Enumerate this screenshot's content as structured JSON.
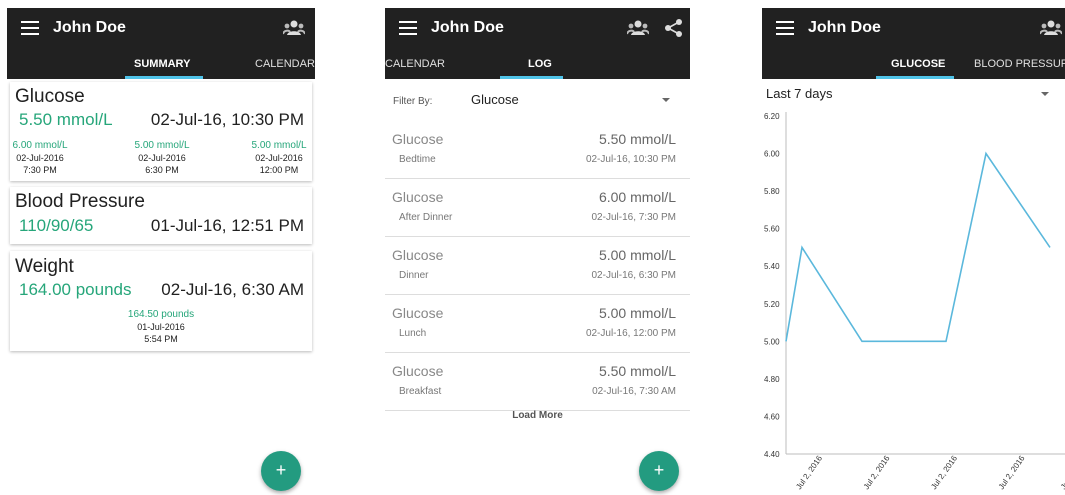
{
  "screens": [
    {
      "title": "John Doe",
      "tabs": [
        {
          "label": "SUMMARY"
        },
        {
          "label": "CALENDAR"
        }
      ],
      "cards": [
        {
          "title": "Glucose",
          "value": "5.50 mmol/L",
          "date": "02-Jul-16, 10:30 PM",
          "history": [
            {
              "value": "6.00 mmol/L",
              "date": "02-Jul-2016",
              "time": "7:30 PM"
            },
            {
              "value": "5.00 mmol/L",
              "date": "02-Jul-2016",
              "time": "6:30 PM"
            },
            {
              "value": "5.00 mmol/L",
              "date": "02-Jul-2016",
              "time": "12:00 PM"
            }
          ]
        },
        {
          "title": "Blood Pressure",
          "value": "110/90/65",
          "date": "01-Jul-16, 12:51 PM"
        },
        {
          "title": "Weight",
          "value": "164.00 pounds",
          "date": "02-Jul-16, 6:30 AM",
          "history": [
            {
              "value": "164.50 pounds",
              "date": "01-Jul-2016",
              "time": "5:54 PM"
            }
          ]
        }
      ],
      "fab": "+"
    },
    {
      "title": "John Doe",
      "tabs": [
        {
          "label": "CALENDAR"
        },
        {
          "label": "LOG"
        }
      ],
      "filter": {
        "label": "Filter By:",
        "value": "Glucose"
      },
      "entries": [
        {
          "type": "Glucose",
          "context": "Bedtime",
          "value": "5.50 mmol/L",
          "datetime": "02-Jul-16, 10:30 PM"
        },
        {
          "type": "Glucose",
          "context": "After Dinner",
          "value": "6.00 mmol/L",
          "datetime": "02-Jul-16, 7:30 PM"
        },
        {
          "type": "Glucose",
          "context": "Dinner",
          "value": "5.00 mmol/L",
          "datetime": "02-Jul-16, 6:30 PM"
        },
        {
          "type": "Glucose",
          "context": "Lunch",
          "value": "5.00 mmol/L",
          "datetime": "02-Jul-16, 12:00 PM"
        },
        {
          "type": "Glucose",
          "context": "Breakfast",
          "value": "5.50 mmol/L",
          "datetime": "02-Jul-16, 7:30 AM"
        }
      ],
      "load_more": "Load More",
      "fab": "+"
    },
    {
      "title": "John Doe",
      "tabs": [
        {
          "label": "GLUCOSE"
        },
        {
          "label": "BLOOD PRESSURE"
        }
      ],
      "range": "Last 7 days"
    }
  ],
  "colors": {
    "appbar": "#212121",
    "accent": "#4fc3e8",
    "value_green": "#26a67a",
    "fab": "#239b80",
    "line": "#5bb8dc"
  },
  "icons": [
    "menu-icon",
    "group-icon",
    "share-icon",
    "dropdown-arrow-icon",
    "add-icon"
  ],
  "chart_data": {
    "type": "line",
    "title": "",
    "xlabel": "",
    "ylabel": "",
    "ylim": [
      4.4,
      6.2
    ],
    "y_ticks": [
      "4.40",
      "4.60",
      "4.80",
      "5.00",
      "5.20",
      "5.40",
      "5.60",
      "5.80",
      "6.00",
      "6.20"
    ],
    "x_tick_labels": [
      "Jul 2, 2016",
      "Jul 2, 2016",
      "Jul 2, 2016",
      "Jul 2, 2016",
      "Jul 2, 2016"
    ],
    "series": [
      {
        "values": [
          5.0,
          5.5,
          5.0,
          5.0,
          6.0,
          5.5
        ],
        "x_ticks": [
          0,
          0.24,
          1.14,
          2.4,
          3.0,
          3.96
        ]
      }
    ],
    "grid": false
  }
}
